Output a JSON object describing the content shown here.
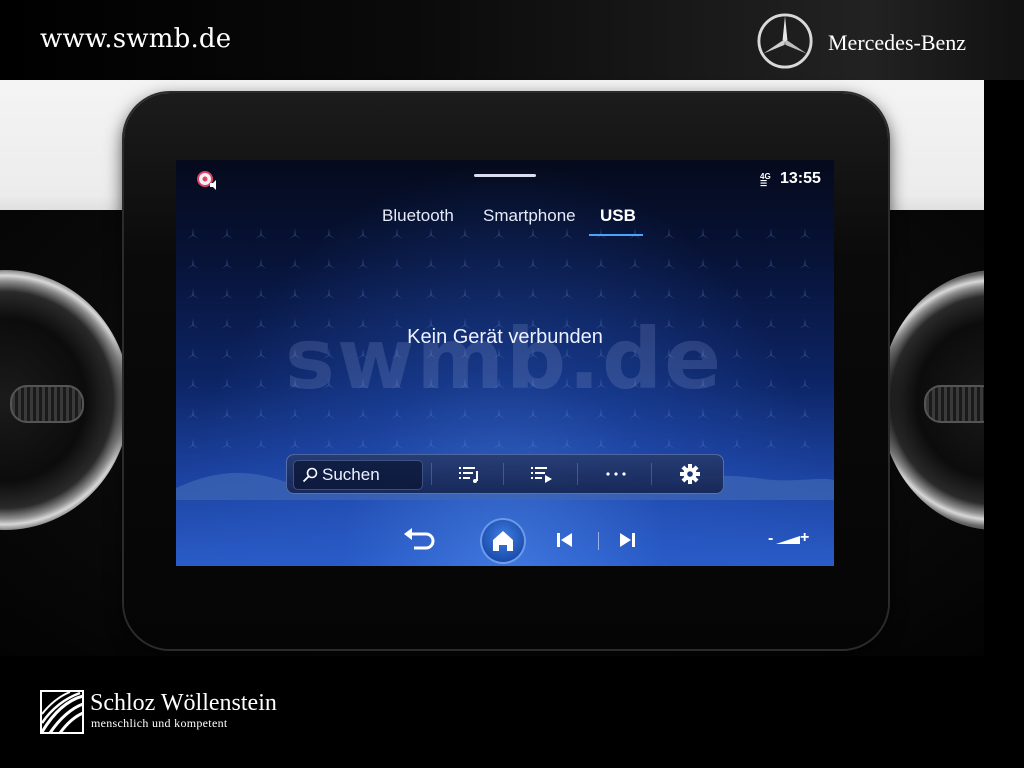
{
  "header": {
    "site_url": "www.swmb.de",
    "brand": "Mercedes-Benz"
  },
  "display": {
    "status": {
      "media_icon": "media-source-icon",
      "network": "4G",
      "time": "13:55"
    },
    "tabs": [
      {
        "label": "Bluetooth",
        "active": false
      },
      {
        "label": "Smartphone",
        "active": false
      },
      {
        "label": "USB",
        "active": true
      }
    ],
    "message": "Kein Gerät verbunden",
    "watermark": "swmb.de",
    "toolbar": {
      "search_label": "Suchen",
      "buttons": [
        "playlist-icon",
        "queue-icon",
        "more-icon",
        "settings-icon"
      ]
    },
    "navbar": {
      "buttons": [
        "back-icon",
        "home-icon",
        "previous-track-icon",
        "next-track-icon",
        "volume-icon"
      ],
      "volume_minus": "-",
      "volume_plus": "+"
    }
  },
  "footer": {
    "dealer_name": "Schloz Wöllenstein",
    "dealer_tagline": "menschlich und kompetent"
  },
  "colors": {
    "accent": "#4aa3ff",
    "screen_blue": "#1a3f9a"
  }
}
